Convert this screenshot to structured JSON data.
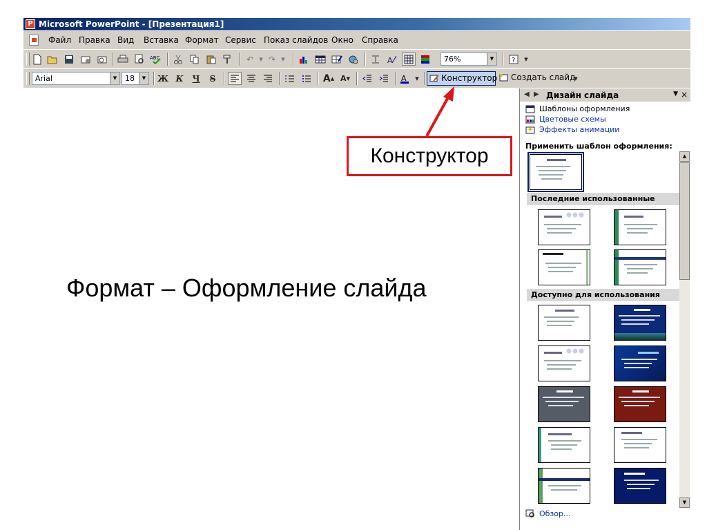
{
  "window": {
    "title": "Microsoft PowerPoint - [Презентация1]",
    "app_icon_letter": "P"
  },
  "menu": {
    "items": [
      "Файл",
      "Правка",
      "Вид",
      "Вставка",
      "Формат",
      "Сервис",
      "Показ слайдов",
      "Окно",
      "Справка"
    ]
  },
  "toolbar_standard": {
    "zoom": "76%",
    "icons": [
      "new-icon",
      "open-icon",
      "save-icon",
      "permission-icon",
      "email-icon",
      "print-icon",
      "print-preview-icon",
      "spelling-icon",
      "cut-icon",
      "copy-icon",
      "paste-icon",
      "format-painter-icon",
      "undo-icon",
      "redo-icon",
      "insert-chart-icon",
      "insert-table-icon",
      "tables-borders-icon",
      "insert-hyperlink-icon",
      "expand-icon",
      "show-formatting-icon",
      "grid-icon",
      "color-grayscale-icon",
      "help-icon"
    ]
  },
  "toolbar_formatting": {
    "font": "Arial",
    "size": "18",
    "bold": "Ж",
    "italic": "К",
    "underline": "Ч",
    "shadow": "S",
    "design_button": "Конструктор",
    "new_slide_button": "Создать слайд"
  },
  "callout": {
    "label": "Конструктор",
    "color": "#e0141b"
  },
  "main": {
    "caption": "Формат – Оформление слайда"
  },
  "taskpane": {
    "title": "Дизайн слайда",
    "links": [
      {
        "label": "Шаблоны оформления",
        "icon": "design-templates-icon"
      },
      {
        "label": "Цветовые схемы",
        "icon": "color-schemes-icon"
      },
      {
        "label": "Эффекты анимации",
        "icon": "animation-schemes-icon"
      }
    ],
    "apply_label": "Применить шаблон оформления:",
    "sections": [
      {
        "label": "Последние использованные"
      },
      {
        "label": "Доступно для использования"
      }
    ],
    "browse": "Обзор..."
  },
  "colors": {
    "title_bar": "#0a246a",
    "chrome": "#d4d0c8",
    "link": "#0033aa"
  }
}
